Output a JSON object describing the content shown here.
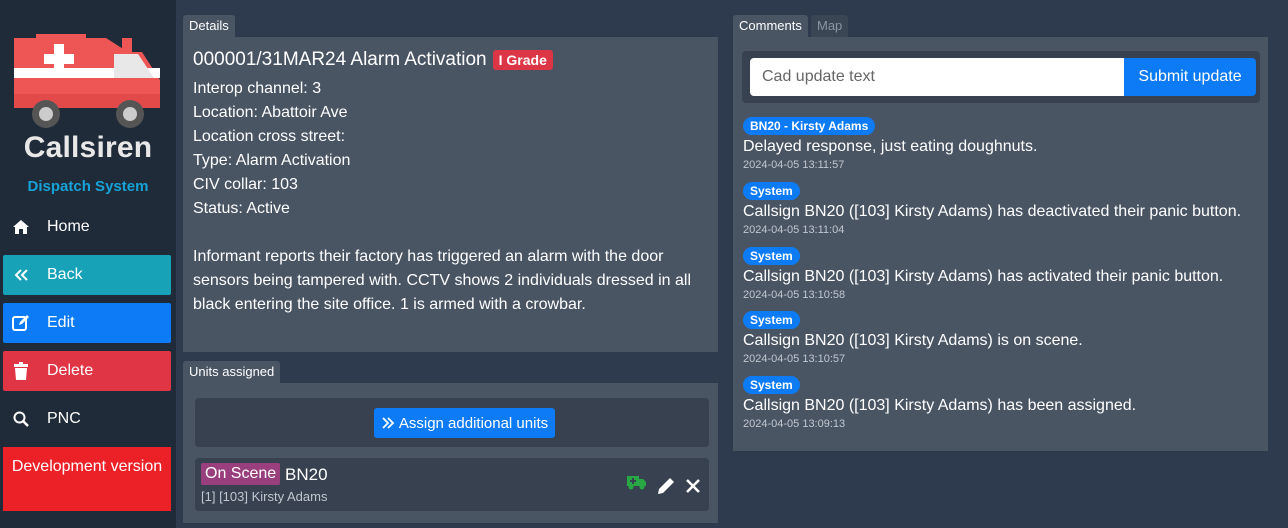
{
  "sidebar": {
    "logo_title": "Callsiren",
    "logo_subtitle": "Dispatch System",
    "items": [
      {
        "label": "Home",
        "icon": "home-icon"
      },
      {
        "label": "Back",
        "icon": "double-chevron-left-icon"
      },
      {
        "label": "Edit",
        "icon": "edit-icon"
      },
      {
        "label": "Delete",
        "icon": "trash-icon"
      },
      {
        "label": "PNC",
        "icon": "search-icon"
      }
    ],
    "dev_notice": "Development version"
  },
  "tabs": {
    "details": "Details",
    "units": "Units assigned",
    "comments": "Comments",
    "map": "Map"
  },
  "details": {
    "title": "000001/31MAR24 Alarm Activation",
    "grade": "I Grade",
    "interop": "Interop channel: 3",
    "location": "Location: Abattoir Ave",
    "cross_street": "Location cross street:",
    "type": "Type: Alarm Activation",
    "civ_collar": "CIV collar: 103",
    "status": "Status: Active",
    "narrative": "Informant reports their factory has triggered an alarm with the door sensors being tampered with. CCTV shows 2 individuals dressed in all black entering the site office. 1 is armed with a crowbar."
  },
  "units": {
    "assign_label": "Assign additional units",
    "rows": [
      {
        "status": "On Scene",
        "callsign": "BN20",
        "members": "[1] [103] Kirsty Adams"
      }
    ]
  },
  "comments": {
    "placeholder": "Cad update text",
    "submit_label": "Submit update",
    "items": [
      {
        "author": "BN20 - Kirsty Adams",
        "text": "Delayed response, just eating doughnuts.",
        "time": "2024-04-05 13:11:57"
      },
      {
        "author": "System",
        "text": "Callsign BN20 ([103] Kirsty Adams) has deactivated their panic button.",
        "time": "2024-04-05 13:11:04"
      },
      {
        "author": "System",
        "text": "Callsign BN20 ([103] Kirsty Adams) has activated their panic button.",
        "time": "2024-04-05 13:10:58"
      },
      {
        "author": "System",
        "text": "Callsign BN20 ([103] Kirsty Adams) is on scene.",
        "time": "2024-04-05 13:10:57"
      },
      {
        "author": "System",
        "text": "Callsign BN20 ([103] Kirsty Adams) has been assigned.",
        "time": "2024-04-05 13:09:13"
      }
    ]
  },
  "colors": {
    "back": "#17a2b8",
    "edit": "#0d7bf5",
    "delete": "#e03545",
    "dev": "#ec2027",
    "on_scene": "#9a3f7d",
    "grade": "#dc3545"
  }
}
